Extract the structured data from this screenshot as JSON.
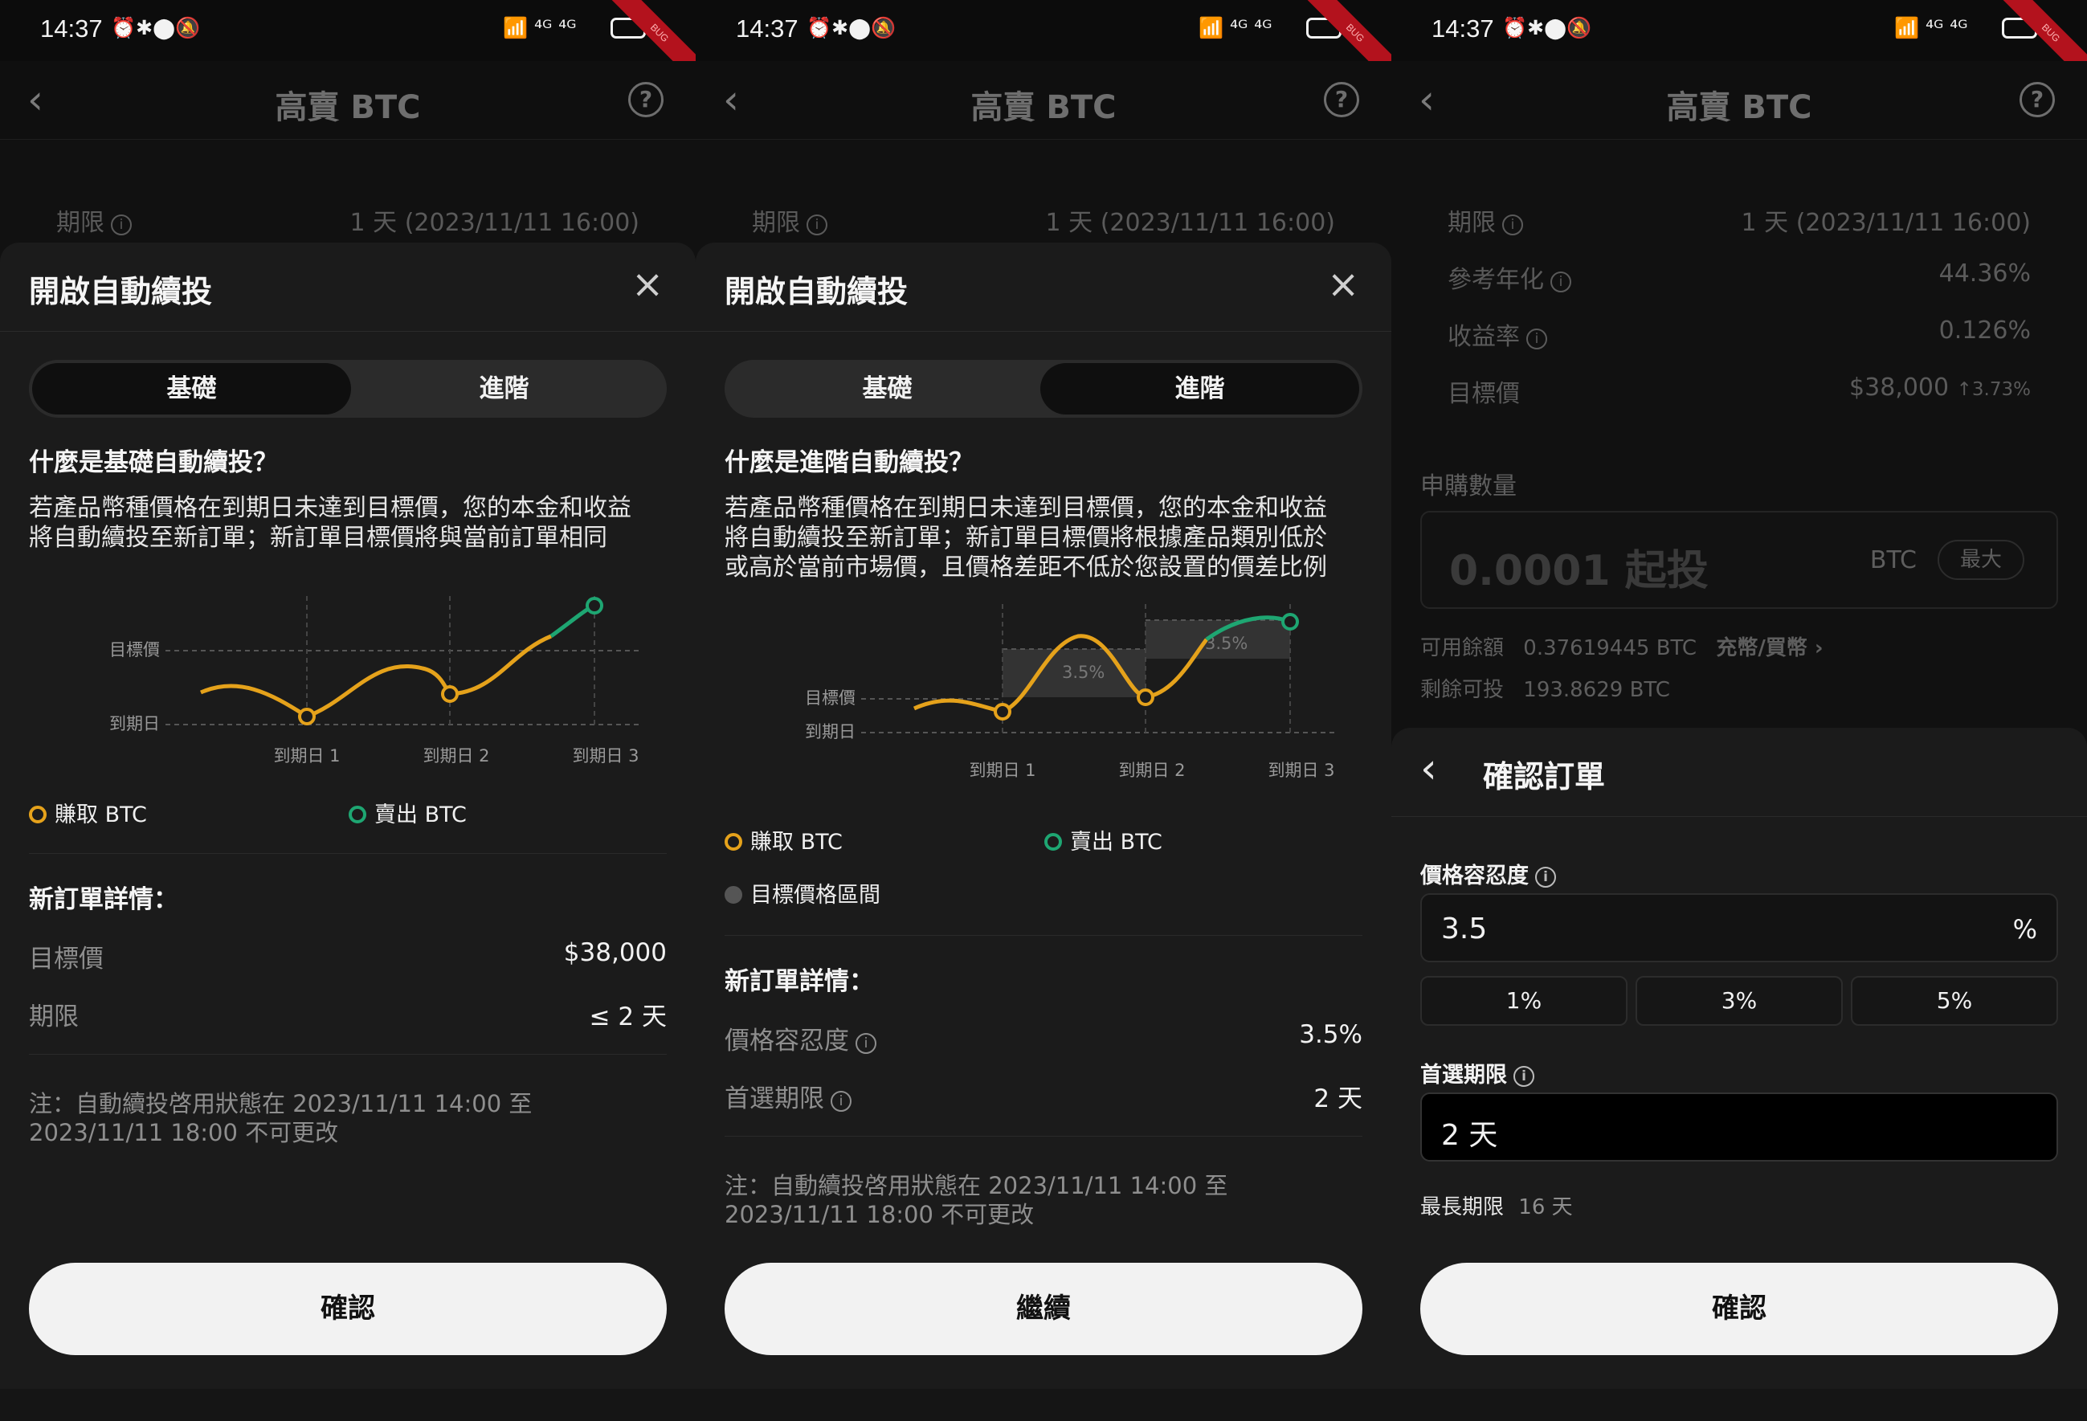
{
  "status_bar": {
    "time": "14:37",
    "left_icons": "⏰✱⬤🔕",
    "right_icons": "📶 ⁴ᴳ ⁴ᴳ",
    "debug_ribbon": "BUG"
  },
  "header": {
    "title": "高賣 BTC"
  },
  "bg": {
    "term_label": "期限",
    "term_value": "1 天 (2023/11/11 16:00)",
    "apr_label": "參考年化",
    "apr_value": "44.36%",
    "yield_label": "收益率",
    "yield_value": "0.126%",
    "target_label": "目標價",
    "target_value": "$38,000",
    "target_change": "3.73%",
    "subscribe_label": "申購數量",
    "amount_placeholder": "0.0001 起投",
    "amount_unit": "BTC",
    "max_label": "最大",
    "available_label": "可用餘額",
    "available_value": "0.37619445 BTC",
    "deposit_link": "充幣/買幣 ›",
    "remaining_label": "剩餘可投",
    "remaining_value": "193.8629 BTC"
  },
  "sheet1": {
    "title": "開啟自動續投",
    "tabs": [
      "基礎",
      "進階"
    ],
    "heading": "什麼是基礎自動續投？",
    "para_l1": "若產品幣種價格在到期日未達到目標價，您的本金和收益",
    "para_l2": "將自動續投至新訂單；新訂單目標價將與當前訂單相同",
    "chart": {
      "y1": "目標價",
      "y2": "到期日",
      "x": [
        "到期日 1",
        "到期日 2",
        "到期日 3"
      ]
    },
    "legend_earn": "賺取 BTC",
    "legend_sell": "賣出 BTC",
    "details_heading": "新訂單詳情：",
    "target_label": "目標價",
    "target_value": "$38,000",
    "term_label": "期限",
    "term_value": "≤ 2 天",
    "note_l1": "注：自動續投啓用狀態在 2023/11/11 14:00 至",
    "note_l2": "2023/11/11 18:00 不可更改",
    "button": "確認"
  },
  "sheet2": {
    "title": "開啟自動續投",
    "tabs": [
      "基礎",
      "進階"
    ],
    "heading": "什麼是進階自動續投？",
    "para_l1": "若產品幣種價格在到期日未達到目標價，您的本金和收益",
    "para_l2": "將自動續投至新訂單；新訂單目標價將根據產品類別低於",
    "para_l3": "或高於當前市場價，且價格差距不低於您設置的價差比例",
    "chart": {
      "y1": "目標價",
      "y2": "到期日",
      "x": [
        "到期日 1",
        "到期日 2",
        "到期日 3"
      ],
      "band1": "3.5%",
      "band2": "3.5%"
    },
    "legend_earn": "賺取 BTC",
    "legend_sell": "賣出 BTC",
    "legend_zone": "目標價格區間",
    "details_heading": "新訂單詳情：",
    "tolerance_label": "價格容忍度",
    "tolerance_value": "3.5%",
    "pref_label": "首選期限",
    "pref_value": "2 天",
    "note_l1": "注：自動續投啓用狀態在 2023/11/11 14:00 至",
    "note_l2": "2023/11/11 18:00 不可更改",
    "button": "繼續"
  },
  "sheet3": {
    "title": "確認訂單",
    "tolerance_label": "價格容忍度",
    "tolerance_value": "3.5",
    "tolerance_unit": "%",
    "chips": [
      "1%",
      "3%",
      "5%"
    ],
    "pref_label": "首選期限",
    "pref_value": "2 天",
    "max_term_label": "最長期限",
    "max_term_value": "16 天",
    "button": "確認"
  },
  "colors": {
    "earn": "#e5a21b",
    "sell": "#1ea672",
    "ribbon": "#b3121d"
  }
}
